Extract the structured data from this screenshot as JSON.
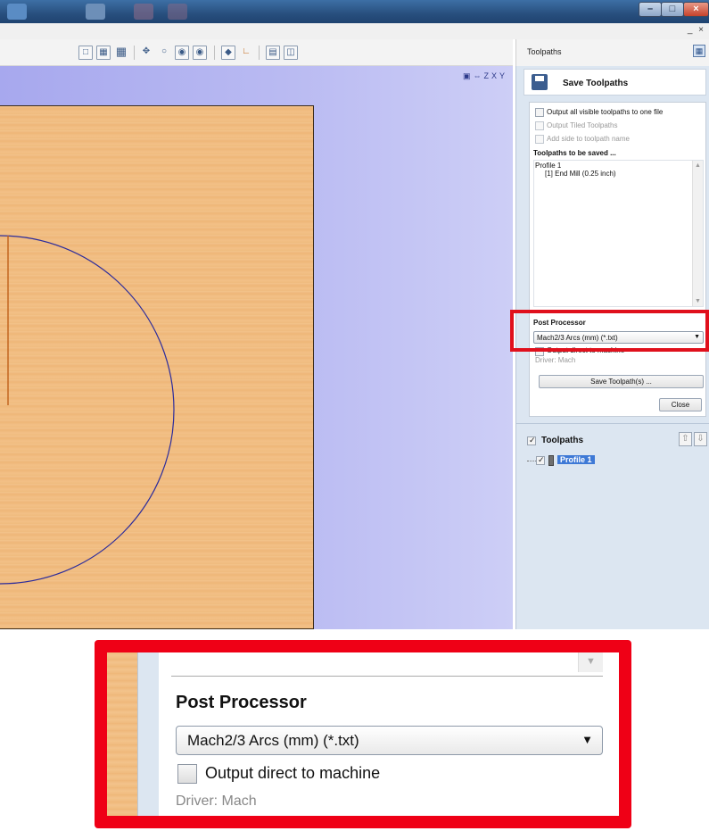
{
  "window": {
    "mdi_controls": "_ ×"
  },
  "colors": {
    "highlight": "#e0101c",
    "view_background": "#b3b4f0",
    "panel_background": "#dce6f1",
    "selection": "#3e79d6"
  },
  "view_toolbar": {
    "icons": [
      "select-icon",
      "snap-icon",
      "grid-icon",
      "pan-icon",
      "zoom-icon",
      "zoom-fit-icon",
      "zoom-box-icon",
      "view-iso-icon",
      "view-axis-icon",
      "layout-icon",
      "split-icon"
    ]
  },
  "view_axis_icons": [
    "zoom-extents-icon",
    "iso-view-icon",
    "z-view-icon",
    "x-view-icon",
    "y-view-icon"
  ],
  "panel": {
    "title": "Toolpaths",
    "save_title": "Save Toolpaths",
    "options": [
      {
        "label": "Output all visible toolpaths to one file",
        "checked": false,
        "enabled": true
      },
      {
        "label": "Output Tiled Toolpaths",
        "checked": false,
        "enabled": false
      },
      {
        "label": "Add side to toolpath name",
        "checked": false,
        "enabled": false
      }
    ],
    "to_be_saved_heading": "Toolpaths to be saved ...",
    "saved_list": [
      "Profile 1",
      "[1] End Mill (0.25 inch)"
    ],
    "post_processor_heading": "Post Processor",
    "post_processor_value": "Mach2/3 Arcs (mm) (*.txt)",
    "output_direct_label": "Output direct to machine",
    "driver_label": "Driver: Mach",
    "save_button": "Save Toolpath(s) ...",
    "close_button": "Close",
    "toolpaths_section_title": "Toolpaths",
    "toolpath_items": [
      {
        "name": "Profile 1",
        "checked": true,
        "selected": true
      }
    ]
  },
  "zoom_inset": {
    "post_processor_heading": "Post Processor",
    "post_processor_value": "Mach2/3 Arcs (mm) (*.txt)",
    "output_direct_label": "Output direct to machine",
    "driver_label": "Driver: Mach"
  }
}
